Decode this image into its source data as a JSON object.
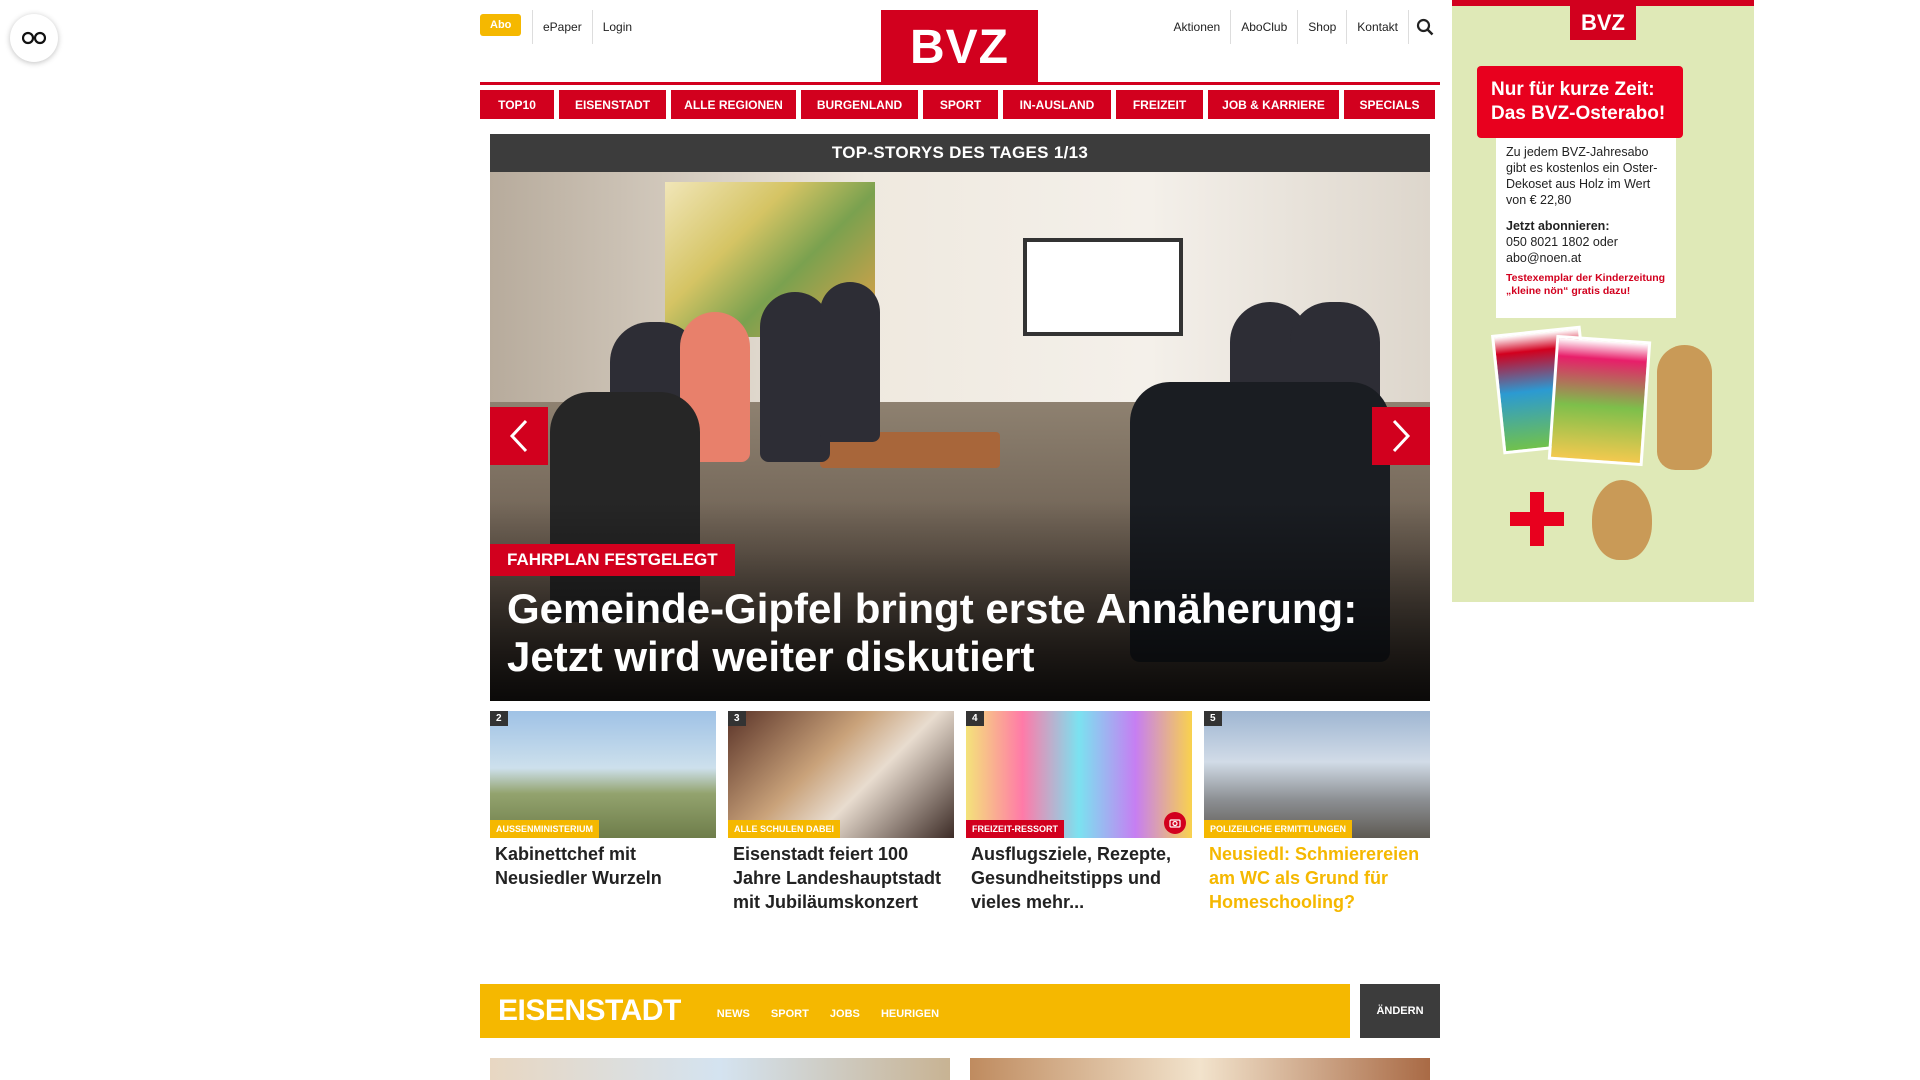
{
  "header": {
    "abo": "Abo",
    "left_links": [
      "ePaper",
      "Login"
    ],
    "logo": "BVZ",
    "right_links": [
      "Aktionen",
      "AboClub",
      "Shop",
      "Kontakt"
    ]
  },
  "nav": {
    "items": [
      "TOP10",
      "EISENSTADT",
      "ALLE REGIONEN",
      "BURGENLAND",
      "SPORT",
      "IN-AUSLAND",
      "FREIZEIT",
      "JOB & KARRIERE",
      "SPECIALS"
    ]
  },
  "hero": {
    "header": "TOP-STORYS DES TAGES 1/13",
    "kicker": "FAHRPLAN FESTGELEGT",
    "headline": "Gemeinde-Gipfel bringt erste Annäherung: Jetzt wird weiter diskutiert"
  },
  "cards": [
    {
      "num": "2",
      "tag": "AUSSENMINISTERIUM",
      "title": "Kabinettchef mit Neusiedler Wurzeln"
    },
    {
      "num": "3",
      "tag": "ALLE SCHULEN DABEI",
      "title": "Eisenstadt feiert 100 Jahre Landeshauptstadt mit Jubiläumskonzert"
    },
    {
      "num": "4",
      "tag": "FREIZEIT-RESSORT",
      "title": "Ausflugsziele, Rezepte, Gesundheitstipps und vieles mehr..."
    },
    {
      "num": "5",
      "tag": "POLIZEILICHE ERMITTLUNGEN",
      "title": "Neusiedl: Schmierereien am WC als Grund für Homeschooling?"
    }
  ],
  "region": {
    "title": "EISENSTADT",
    "links": [
      "NEWS",
      "SPORT",
      "JOBS",
      "HEURIGEN"
    ],
    "change": "ÄNDERN"
  },
  "ad": {
    "logo": "BVZ",
    "banner": "Nur für kurze Zeit: Das BVZ-Osterabo!",
    "text1": "Zu jedem BVZ-Jahresabo gibt es kostenlos ein Oster-Dekoset aus Holz im Wert von € 22,80",
    "text2_head": "Jetzt abonnieren:",
    "text2": "050 8021 1802 oder abo@noen.at",
    "small": "Testexemplar der Kinderzeitung „kleine nön“ gratis dazu!"
  },
  "colors": {
    "brand_red": "#d2001e",
    "accent_yellow": "#f5b800",
    "dark_bar": "#3c3c3c"
  }
}
